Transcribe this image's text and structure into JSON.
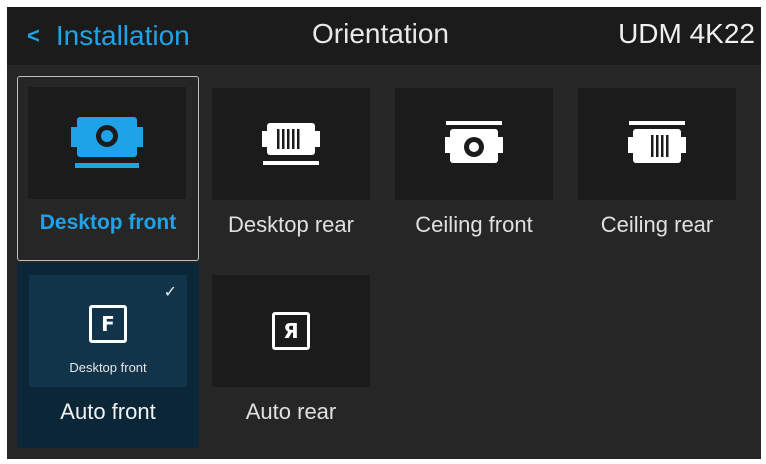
{
  "header": {
    "back_label": "Installation",
    "title": "Orientation",
    "device": "UDM 4K22"
  },
  "colors": {
    "accent": "#1fa3e8",
    "background": "#262626",
    "tile": "#1b1b1b",
    "selected_tile": "#0b2637"
  },
  "tiles": [
    {
      "label": "Desktop front",
      "icon": "projector-desktop-front-icon",
      "state": "focused"
    },
    {
      "label": "Desktop rear",
      "icon": "projector-desktop-rear-icon",
      "state": "normal"
    },
    {
      "label": "Ceiling front",
      "icon": "projector-ceiling-front-icon",
      "state": "normal"
    },
    {
      "label": "Ceiling rear",
      "icon": "projector-ceiling-rear-icon",
      "state": "normal"
    },
    {
      "label": "Auto front",
      "icon": "letter-f-icon",
      "glyph": "F",
      "sublabel": "Desktop front",
      "state": "selected",
      "check": "✓"
    },
    {
      "label": "Auto rear",
      "icon": "letter-r-mirrored-icon",
      "glyph": "Я",
      "state": "normal"
    }
  ]
}
